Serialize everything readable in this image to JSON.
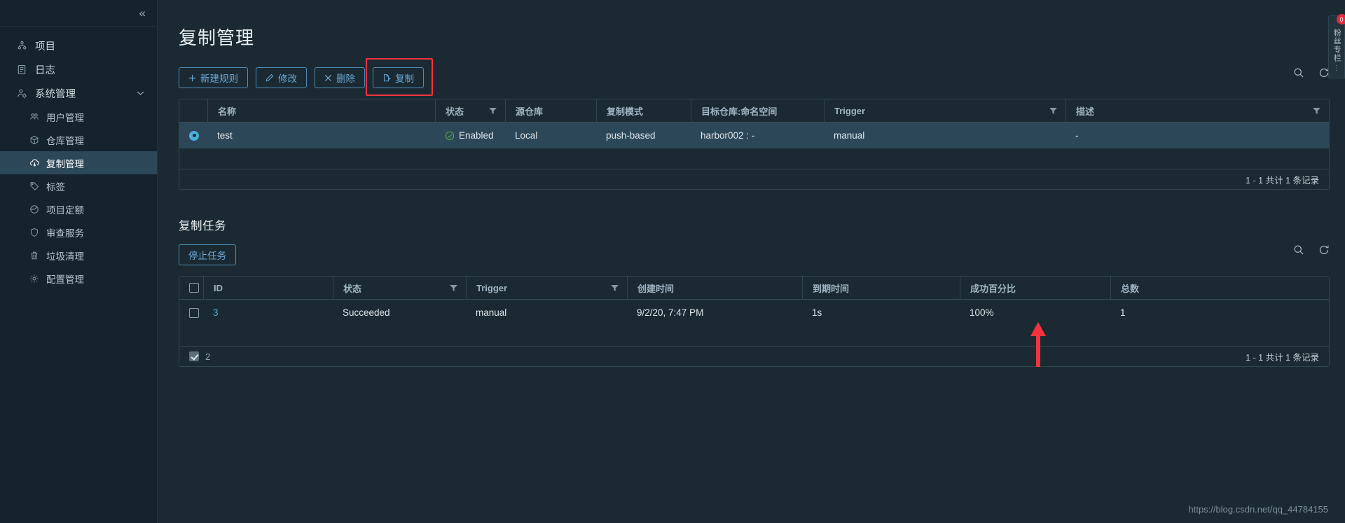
{
  "sidebar": {
    "collapse_label": "«",
    "items": [
      {
        "label": "项目",
        "icon": "users-group-icon",
        "level": "top",
        "active": false
      },
      {
        "label": "日志",
        "icon": "list-log-icon",
        "level": "top",
        "active": false
      },
      {
        "label": "系统管理",
        "icon": "user-settings-icon",
        "level": "top",
        "active": false,
        "chevron": "⌄"
      },
      {
        "label": "用户管理",
        "icon": "users-icon",
        "level": "sub",
        "active": false
      },
      {
        "label": "仓库管理",
        "icon": "cube-icon",
        "level": "sub",
        "active": false
      },
      {
        "label": "复制管理",
        "icon": "replication-cloud-icon",
        "level": "sub",
        "active": true
      },
      {
        "label": "标签",
        "icon": "tag-icon",
        "level": "sub",
        "active": false
      },
      {
        "label": "项目定额",
        "icon": "pie-chart-icon",
        "level": "sub",
        "active": false
      },
      {
        "label": "审查服务",
        "icon": "shield-icon",
        "level": "sub",
        "active": false
      },
      {
        "label": "垃圾清理",
        "icon": "trash-icon",
        "level": "sub",
        "active": false
      },
      {
        "label": "配置管理",
        "icon": "gear-icon",
        "level": "sub",
        "active": false
      }
    ]
  },
  "page": {
    "title": "复制管理"
  },
  "toolbar": {
    "new_rule": "新建规则",
    "edit": "修改",
    "delete": "删除",
    "replicate": "复制",
    "new_rule_icon": "plus-icon",
    "edit_icon": "pencil-icon",
    "delete_icon": "close-x-icon",
    "replicate_icon": "copy-icon",
    "search_icon": "search-icon",
    "refresh_icon": "refresh-icon",
    "highlight_color": "#f5333f"
  },
  "rules_table": {
    "columns": [
      "名称",
      "状态",
      "源仓库",
      "复制模式",
      "目标仓库:命名空间",
      "Trigger",
      "描述"
    ],
    "filter_columns": [
      false,
      true,
      false,
      false,
      false,
      true,
      true
    ],
    "rows": [
      {
        "selected": true,
        "name": "test",
        "status": "Enabled",
        "source_registry": "Local",
        "mode": "push-based",
        "destination": "harbor002 : -",
        "trigger": "manual",
        "description": "-"
      }
    ],
    "footer": "1 - 1 共计 1 条记录"
  },
  "tasks_section": {
    "title": "复制任务",
    "stop_button": "停止任务",
    "search_icon": "search-icon",
    "refresh_icon": "refresh-icon"
  },
  "tasks_table": {
    "columns": [
      "ID",
      "状态",
      "Trigger",
      "创建时间",
      "到期时间",
      "成功百分比",
      "总数"
    ],
    "filter_columns": [
      false,
      true,
      true,
      false,
      false,
      false,
      false
    ],
    "rows": [
      {
        "checked": false,
        "id": "3",
        "status": "Succeeded",
        "trigger": "manual",
        "created": "9/2/20, 7:47 PM",
        "duration": "1s",
        "success_rate": "100%",
        "total": "1"
      }
    ],
    "footer_left_count": "2",
    "footer_left_checked": true,
    "footer": "1 - 1 共计 1 条记录"
  },
  "annotations": {
    "arrow_color": "#f5333f",
    "arrow_target": "成功百分比"
  },
  "right_rail": {
    "badge": "0",
    "text": "粉丝专栏",
    "dots": "⋮"
  },
  "watermark": "https://blog.csdn.net/qq_44784155"
}
